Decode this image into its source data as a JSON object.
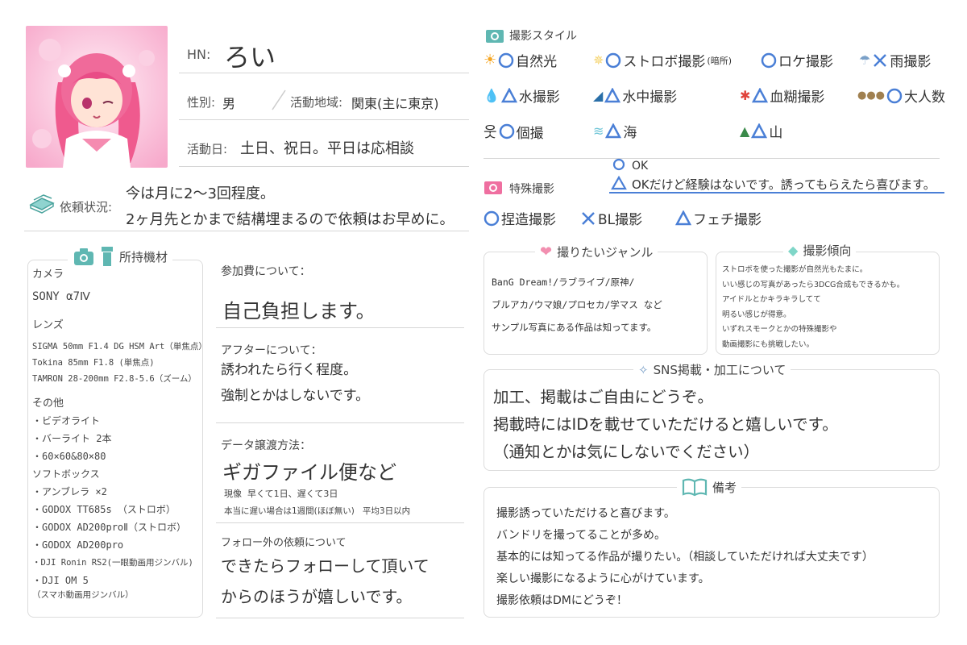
{
  "profile": {
    "hn_label": "HN:",
    "hn_value": "ろい",
    "gender_label": "性別:",
    "gender_value": "男",
    "area_label": "活動地域:",
    "area_value": "関東(主に東京)",
    "days_label": "活動日:",
    "days_value": "土日、祝日。平日は応相談",
    "request_label": "依頼状況:",
    "request_line1": "今は月に2〜3回程度。",
    "request_line2": "2ヶ月先とかまで結構埋まるので依頼はお早めに。"
  },
  "equipment": {
    "title": "所持機材",
    "camera_heading": "カメラ",
    "camera": "SONY α7Ⅳ",
    "lens_heading": "レンズ",
    "lenses": [
      "SIGMA 50mm F1.4 DG HSM Art（単焦点）",
      "Tokina  85mm F1.8  (単焦点)",
      "TAMRON 28-200mm F2.8-5.6（ズーム）"
    ],
    "other_heading": "その他",
    "other": [
      "・ビデオライト",
      "・バーライト  2本",
      "・60×60&80×80",
      "  ソフトボックス",
      "・アンブレラ  ×2",
      "・GODOX  TT685s （ストロボ）",
      "・GODOX  AD200proⅡ（ストロボ）",
      "・GODOX  AD200pro",
      "・DJI Ronin RS2(一眼動画用ジンバル)",
      "・DJI OM 5",
      "（スマホ動画用ジンバル）"
    ]
  },
  "middle": {
    "fee_label": "参加費について：",
    "fee_value": "自己負担します。",
    "after_label": "アフターについて：",
    "after_line1": "誘われたら行く程度。",
    "after_line2": "強制とかはしないです。",
    "data_label": "データ譲渡方法：",
    "data_value": "ギガファイル便など",
    "data_note1": "現像  早くて1日、遅くて3日",
    "data_note2": "本当に遅い場合は1週間(ほぼ無い)   平均3日以内",
    "follow_label": "フォロー外の依頼について",
    "follow_line1": "できたらフォローして頂いて",
    "follow_line2": "からのほうが嬉しいです。"
  },
  "styles": {
    "title": "撮影スタイル",
    "items": [
      {
        "label": "自然光",
        "mark": "o",
        "icon": "sun-icon"
      },
      {
        "label": "ストロボ撮影",
        "sub": "(暗所)",
        "mark": "o",
        "icon": "sparkle-icon"
      },
      {
        "label": "ロケ撮影",
        "mark": "o",
        "icon": ""
      },
      {
        "label": "雨撮影",
        "mark": "x",
        "icon": "umbrella-icon"
      },
      {
        "label": "水撮影",
        "mark": "tri",
        "icon": "drop-icon"
      },
      {
        "label": "水中撮影",
        "mark": "tri",
        "icon": "wave-icon"
      },
      {
        "label": "血糊撮影",
        "mark": "tri",
        "icon": "blood-icon"
      },
      {
        "label": "大人数",
        "mark": "o",
        "icon": "people-icon"
      },
      {
        "label": "個撮",
        "mark": "o",
        "icon": "person-icon"
      },
      {
        "label": "海",
        "mark": "tri",
        "icon": "sea-icon"
      },
      {
        "label": "山",
        "mark": "tri",
        "icon": "mountain-icon"
      }
    ],
    "legend_ok": "OK",
    "legend_tri": "OKだけど経験はないです。誘ってもらえたら喜びます。",
    "special_title": "特殊撮影",
    "special_items": [
      {
        "label": "捏造撮影",
        "mark": "o"
      },
      {
        "label": "BL撮影",
        "mark": "x"
      },
      {
        "label": "フェチ撮影",
        "mark": "tri"
      }
    ]
  },
  "genre": {
    "title": "撮りたいジャンル",
    "line1": "BanG Dream!/ラブライブ/原神/",
    "line2": "ブルアカ/ウマ娘/プロセカ/学マス など",
    "line3": "サンプル写真にある作品は知ってます。"
  },
  "tendency": {
    "title": "撮影傾向",
    "lines": [
      "ストロボを使った撮影が自然光もたまに。",
      "いい感じの写真があったら3DCG合成もできるかも。",
      "アイドルとかキラキラしてて",
      "明るい感じが得意。",
      "いずれスモークとかの特殊撮影や",
      "動画撮影にも挑戦したい。"
    ]
  },
  "sns": {
    "title": "SNS掲載・加工について",
    "line1": "加工、掲載はご自由にどうぞ。",
    "line2": "掲載時にはIDを載せていただけると嬉しいです。",
    "line3": "（通知とかは気にしないでください）"
  },
  "notes": {
    "title": "備考",
    "lines": [
      "撮影誘っていただけると喜びます。",
      "バンドリを撮ってることが多め。",
      "基本的には知ってる作品が撮りたい。（相談していただければ大丈夫です）",
      "楽しい撮影になるように心がけています。",
      "撮影依頼はDMにどうぞ！"
    ]
  },
  "colors": {
    "accent": "#4a7fd6",
    "pink": "#ef8fb0",
    "teal": "#5fb7b2"
  }
}
